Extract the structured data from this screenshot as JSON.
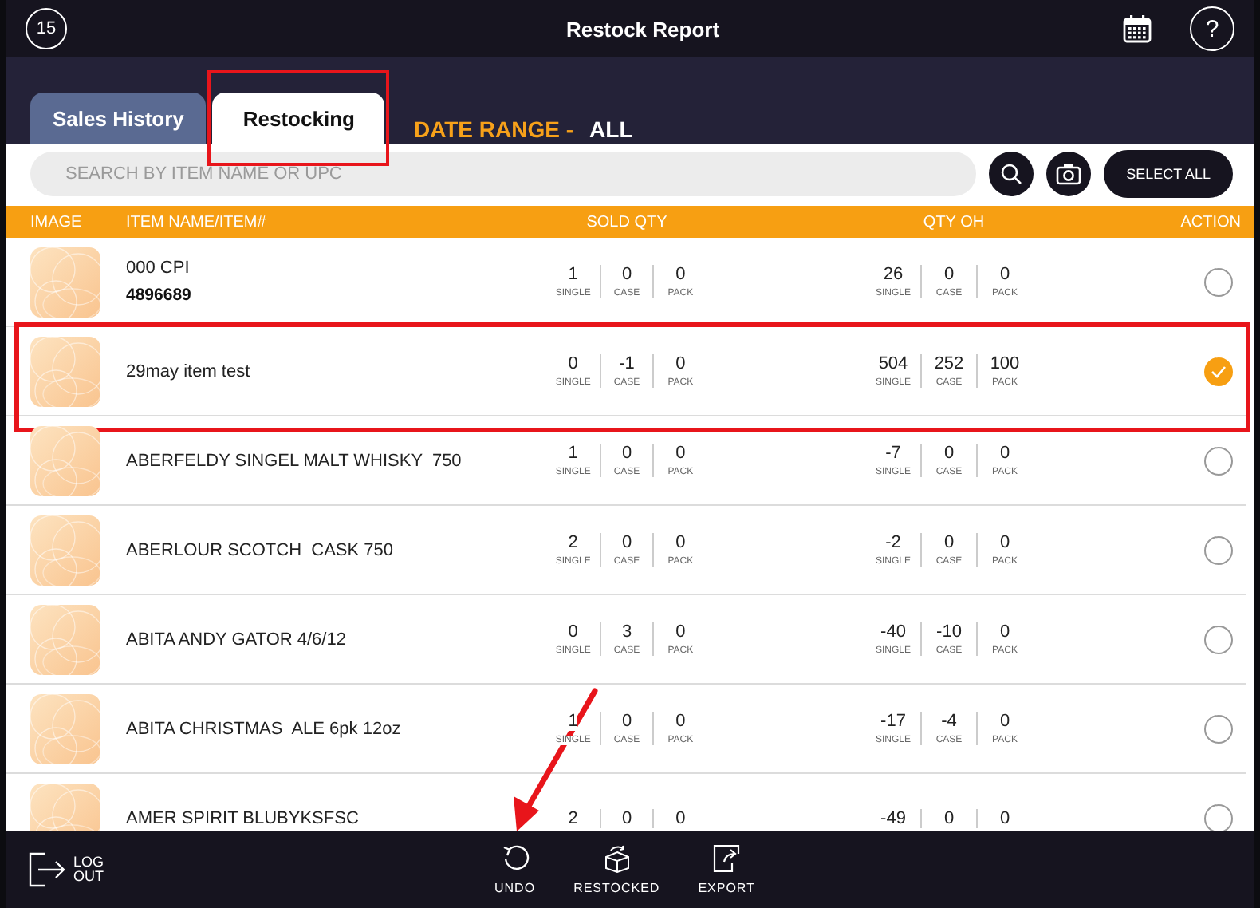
{
  "header": {
    "date_badge": "15",
    "title": "Restock Report",
    "help": "?"
  },
  "tabs": [
    {
      "label": "Sales History",
      "selected": false,
      "highlighted": false
    },
    {
      "label": "Restocking",
      "selected": true,
      "highlighted": true
    }
  ],
  "date_range": {
    "label": "DATE RANGE -",
    "value": "ALL"
  },
  "search": {
    "placeholder": "SEARCH BY ITEM NAME OR UPC"
  },
  "select_all": "SELECT ALL",
  "columns": [
    "IMAGE",
    "ITEM NAME/ITEM#",
    "SOLD QTY",
    "QTY OH",
    "ACTION"
  ],
  "rows": [
    {
      "name": "000 CPI",
      "item_no": "4896689",
      "sold": [
        {
          "value": "1",
          "unit": "SINGLE"
        },
        {
          "value": "0",
          "unit": "CASE"
        },
        {
          "value": "0",
          "unit": "PACK"
        }
      ],
      "on_hand": [
        {
          "value": "26",
          "unit": "SINGLE"
        },
        {
          "value": "0",
          "unit": "CASE"
        },
        {
          "value": "0",
          "unit": "PACK"
        }
      ],
      "selected": false,
      "highlighted": false
    },
    {
      "name": "29may item test",
      "sold": [
        {
          "value": "0",
          "unit": "SINGLE"
        },
        {
          "value": "-1",
          "unit": "CASE"
        },
        {
          "value": "0",
          "unit": "PACK"
        }
      ],
      "on_hand": [
        {
          "value": "504",
          "unit": "SINGLE"
        },
        {
          "value": "252",
          "unit": "CASE"
        },
        {
          "value": "100",
          "unit": "PACK"
        }
      ],
      "selected": true,
      "highlighted": true
    },
    {
      "name": "ABERFELDY SINGEL MALT WHISKY  750",
      "sold": [
        {
          "value": "1",
          "unit": "SINGLE"
        },
        {
          "value": "0",
          "unit": "CASE"
        },
        {
          "value": "0",
          "unit": "PACK"
        }
      ],
      "on_hand": [
        {
          "value": "-7",
          "unit": "SINGLE"
        },
        {
          "value": "0",
          "unit": "CASE"
        },
        {
          "value": "0",
          "unit": "PACK"
        }
      ],
      "selected": false,
      "highlighted": false
    },
    {
      "name": "ABERLOUR SCOTCH  CASK 750",
      "sold": [
        {
          "value": "2",
          "unit": "SINGLE"
        },
        {
          "value": "0",
          "unit": "CASE"
        },
        {
          "value": "0",
          "unit": "PACK"
        }
      ],
      "on_hand": [
        {
          "value": "-2",
          "unit": "SINGLE"
        },
        {
          "value": "0",
          "unit": "CASE"
        },
        {
          "value": "0",
          "unit": "PACK"
        }
      ],
      "selected": false,
      "highlighted": false
    },
    {
      "name": "ABITA ANDY GATOR 4/6/12",
      "sold": [
        {
          "value": "0",
          "unit": "SINGLE"
        },
        {
          "value": "3",
          "unit": "CASE"
        },
        {
          "value": "0",
          "unit": "PACK"
        }
      ],
      "on_hand": [
        {
          "value": "-40",
          "unit": "SINGLE"
        },
        {
          "value": "-10",
          "unit": "CASE"
        },
        {
          "value": "0",
          "unit": "PACK"
        }
      ],
      "selected": false,
      "highlighted": false
    },
    {
      "name": "ABITA CHRISTMAS  ALE 6pk 12oz",
      "sold": [
        {
          "value": "1",
          "unit": "SINGLE"
        },
        {
          "value": "0",
          "unit": "CASE"
        },
        {
          "value": "0",
          "unit": "PACK"
        }
      ],
      "on_hand": [
        {
          "value": "-17",
          "unit": "SINGLE"
        },
        {
          "value": "-4",
          "unit": "CASE"
        },
        {
          "value": "0",
          "unit": "PACK"
        }
      ],
      "selected": false,
      "highlighted": false
    },
    {
      "name": "AMER SPIRIT BLUBYKSFSC",
      "sold": [
        {
          "value": "2"
        },
        {
          "value": "0"
        },
        {
          "value": "0"
        }
      ],
      "on_hand": [
        {
          "value": "-49"
        },
        {
          "value": "0"
        },
        {
          "value": "0"
        }
      ],
      "selected": false,
      "highlighted": false
    }
  ],
  "footer": {
    "logout": "LOG\nOUT",
    "actions": [
      {
        "kind": "undo",
        "label": "UNDO",
        "pointed": true
      },
      {
        "kind": "restocked",
        "label": "RESTOCKED",
        "pointed": false
      },
      {
        "kind": "export",
        "label": "EXPORT",
        "pointed": false
      }
    ]
  }
}
